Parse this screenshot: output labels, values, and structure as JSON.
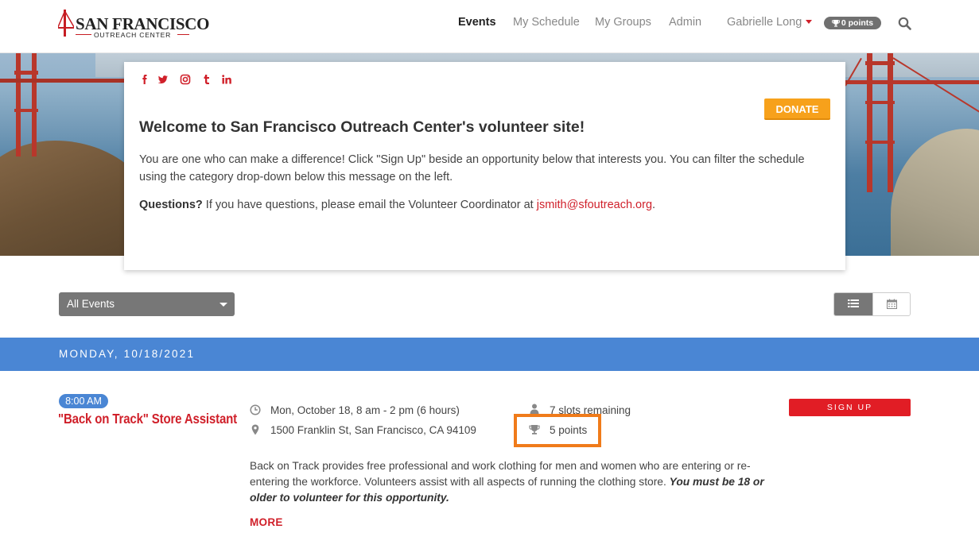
{
  "brand": {
    "logo_line1": "SAN FRANCISCO",
    "logo_line2": "OUTREACH CENTER"
  },
  "nav": {
    "events": "Events",
    "my_schedule": "My Schedule",
    "my_groups": "My Groups",
    "admin": "Admin",
    "user_name": "Gabrielle Long",
    "points": "0 points"
  },
  "welcome": {
    "social_icons": [
      "facebook-icon",
      "twitter-icon",
      "instagram-icon",
      "tumblr-icon",
      "linkedin-icon"
    ],
    "donate_label": "DONATE",
    "title": "Welcome to San Francisco Outreach Center's volunteer site!",
    "body": "You are one who can make a difference! Click \"Sign Up\" beside an opportunity below that interests you. You can filter the schedule using the category drop-down below this message on the left.",
    "questions_label": "Questions?",
    "questions_text": " If you have questions, please email the Volunteer Coordinator at ",
    "email": "jsmith@sfoutreach.org",
    "questions_end": "."
  },
  "filter": {
    "selected": "All Events"
  },
  "date_header": "MONDAY, 10/18/2021",
  "event": {
    "time": "8:00 AM",
    "title": "\"Back on Track\" Store Assistant",
    "datetime": "Mon, October 18, 8 am - 2 pm (6 hours)",
    "address": "1500 Franklin St, San Francisco, CA 94109",
    "slots": "7 slots remaining",
    "points": "5 points",
    "signup_label": "SIGN UP",
    "description": "Back on Track provides free professional and work clothing for men and women who are entering or re-entering the workforce. Volunteers assist with all aspects of running the clothing store. ",
    "description_emphasis": "You must be 18 or older to volunteer for this opportunity.",
    "more_label": "MORE"
  },
  "colors": {
    "brand_red": "#d0202a",
    "date_bar_blue": "#4a86d4",
    "donate_orange": "#f7a11b",
    "highlight_orange": "#f07b1a"
  }
}
